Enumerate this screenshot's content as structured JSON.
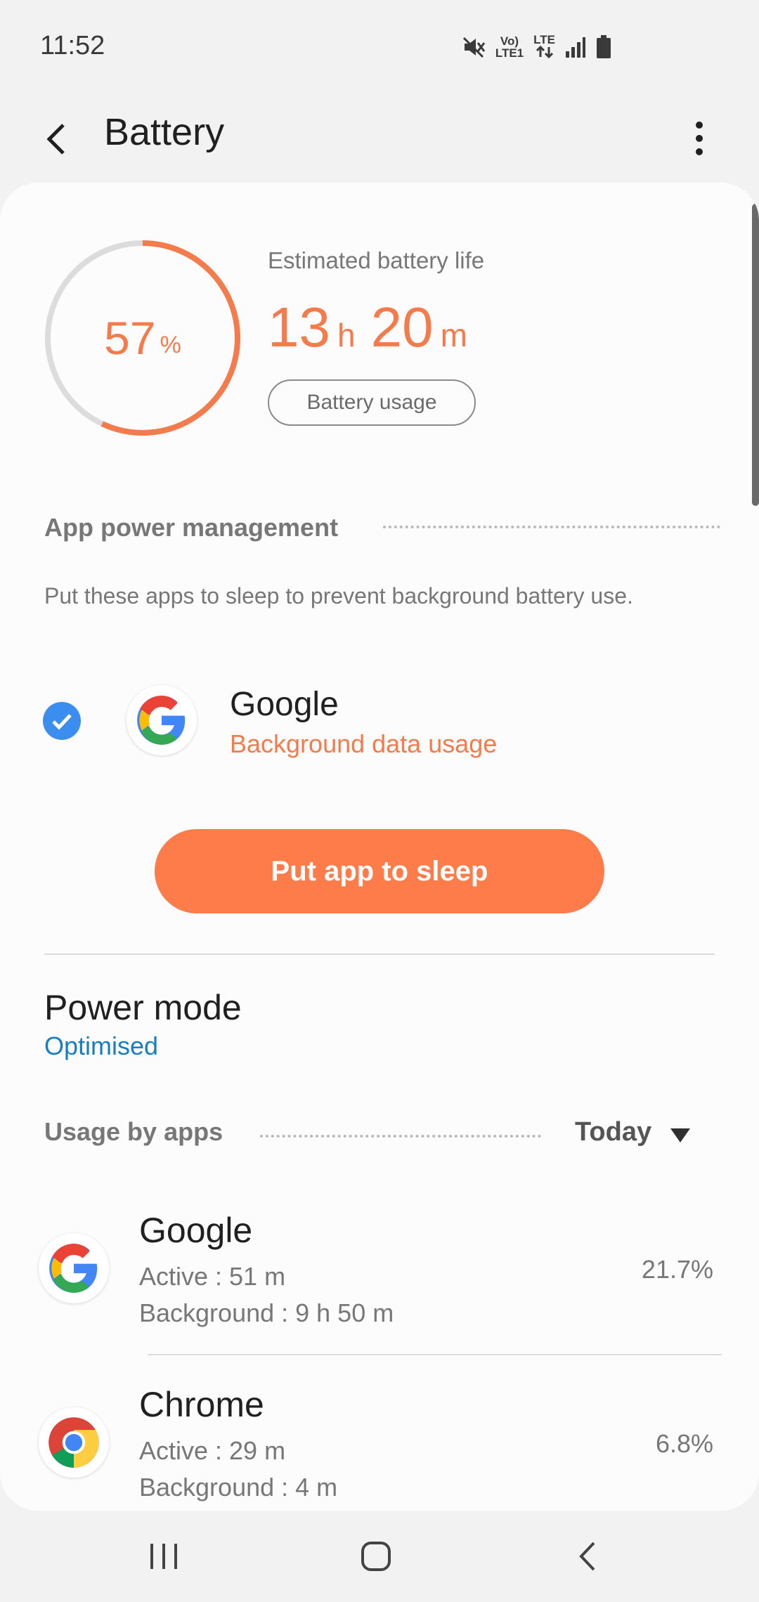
{
  "status_bar": {
    "time": "11:52",
    "net_top": "Vo)",
    "net_bottom": "LTE1",
    "lte_label": "LTE",
    "icons": [
      "mute-icon",
      "volte-indicator",
      "lte-arrows-icon",
      "signal-icon",
      "battery-icon"
    ]
  },
  "app_bar": {
    "title": "Battery",
    "back_icon": "back-arrow-icon",
    "more_icon": "more-vert-icon"
  },
  "battery": {
    "percent_value": 57,
    "percent_number": "57",
    "percent_unit": "%",
    "estimated_label": "Estimated battery life",
    "hours": "13",
    "hours_unit": "h",
    "minutes": "20",
    "minutes_unit": "m",
    "usage_button": "Battery usage"
  },
  "app_power": {
    "title": "App power management",
    "description": "Put these apps to sleep to prevent background battery use.",
    "app": {
      "name": "Google",
      "subtitle": "Background data usage",
      "checked": true
    },
    "sleep_button": "Put app to sleep"
  },
  "power_mode": {
    "title": "Power mode",
    "value": "Optimised"
  },
  "usage": {
    "title": "Usage by apps",
    "period": "Today",
    "apps": [
      {
        "name": "Google",
        "active": "Active : 51 m",
        "background": "Background : 9 h 50 m",
        "percent": "21.7%",
        "icon": "google-icon"
      },
      {
        "name": "Chrome",
        "active": "Active : 29 m",
        "background": "Background : 4 m",
        "percent": "6.8%",
        "icon": "chrome-icon"
      }
    ]
  },
  "nav": {
    "recents_icon": "recents-icon",
    "home_icon": "home-icon",
    "back_icon": "nav-back-icon"
  },
  "colors": {
    "accent": "#fe7b4a",
    "link": "#1a7dc0",
    "check": "#3b8ef0"
  }
}
